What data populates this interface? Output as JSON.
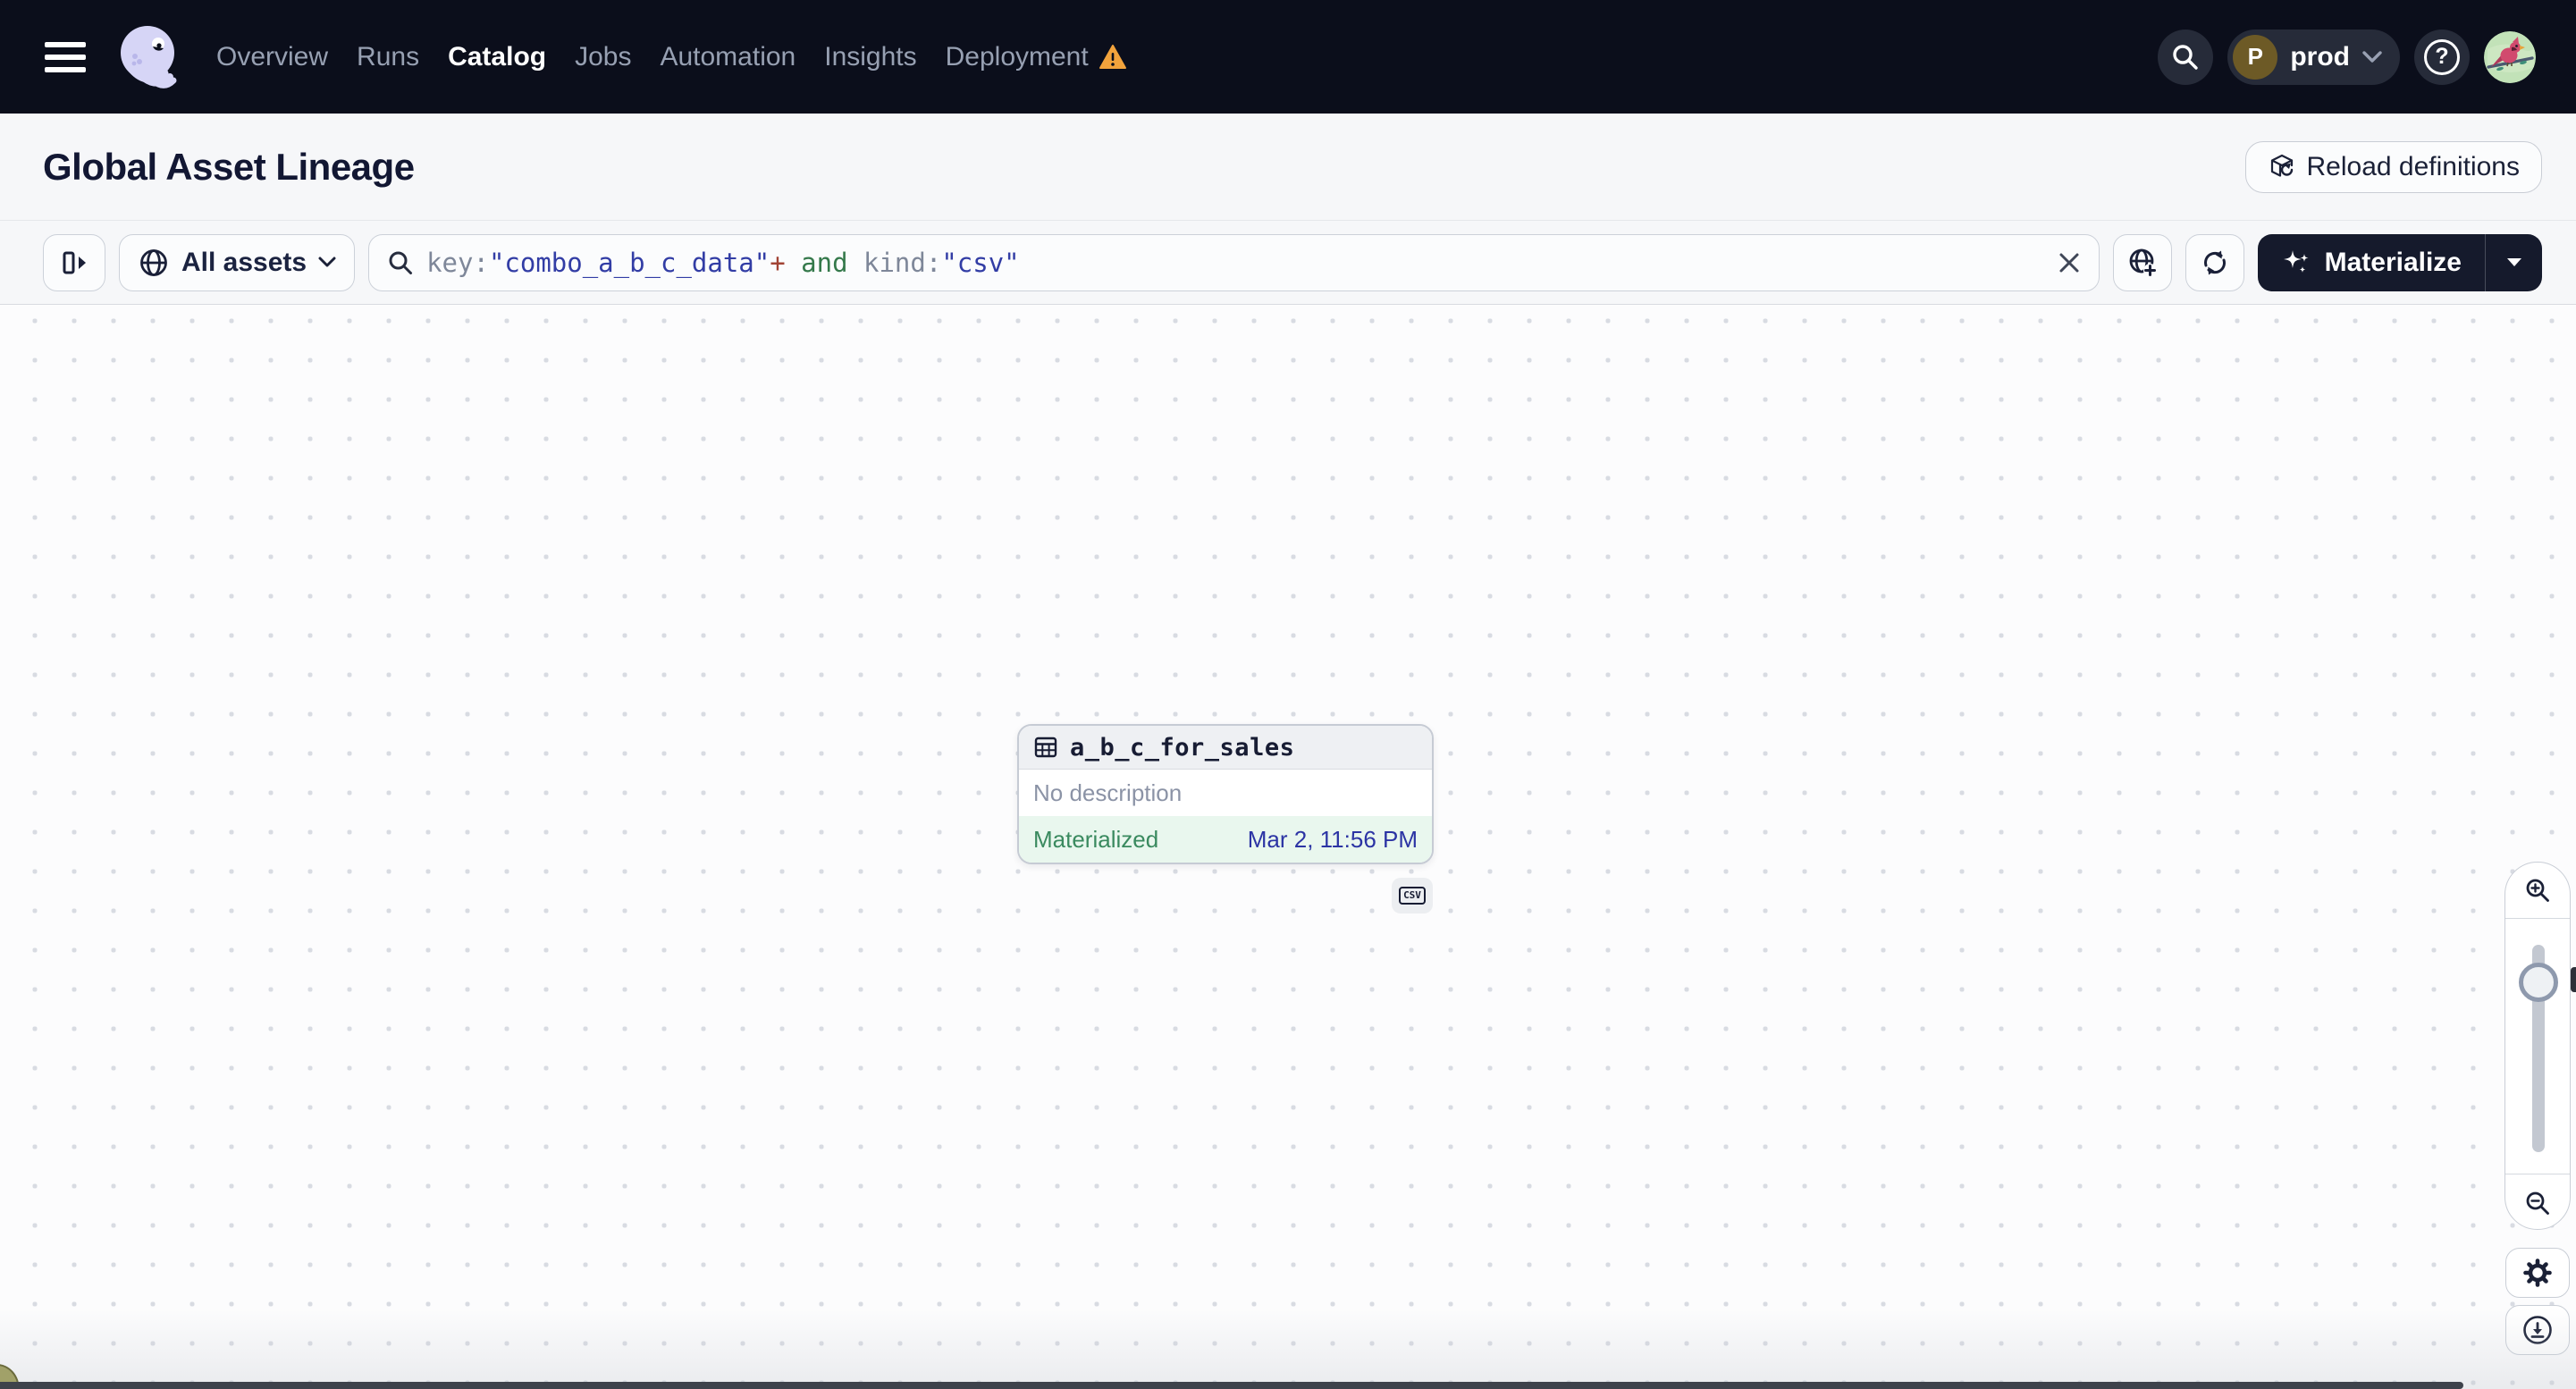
{
  "topbar": {
    "nav": [
      "Overview",
      "Runs",
      "Catalog",
      "Jobs",
      "Automation",
      "Insights",
      "Deployment"
    ],
    "active_item": "Catalog",
    "deployment_has_warning": true,
    "env": {
      "label": "prod",
      "avatar_letter": "P"
    },
    "help_glyph": "?"
  },
  "header": {
    "title": "Global Asset Lineage",
    "reload_button_label": "Reload definitions"
  },
  "filterbar": {
    "scope_label": "All assets",
    "query_segments": [
      "key:",
      "\"combo_a_b_c_data\"",
      "+",
      " and ",
      "kind:",
      "\"csv\""
    ],
    "materialize_label": "Materialize"
  },
  "graph": {
    "node": {
      "title": "a_b_c_for_sales",
      "description": "No description",
      "status": "Materialized",
      "timestamp": "Mar 2, 11:56 PM",
      "kind_badge": "CSV"
    }
  },
  "colors": {
    "topbar_bg": "#0b0e1b",
    "row_bg": "#f6f7f9",
    "dark_button_bg": "#151a2c",
    "warning_orange": "#f2a33c",
    "materialized_green_bg": "#e9f7ee",
    "materialized_green_text": "#3a8a5f",
    "timestamp_blue": "#2c34a4",
    "query_string_indigo": "#323da5",
    "query_and_green": "#35794b",
    "query_plus_red": "#a14334",
    "logo_lavender": "#d6d5f6"
  }
}
